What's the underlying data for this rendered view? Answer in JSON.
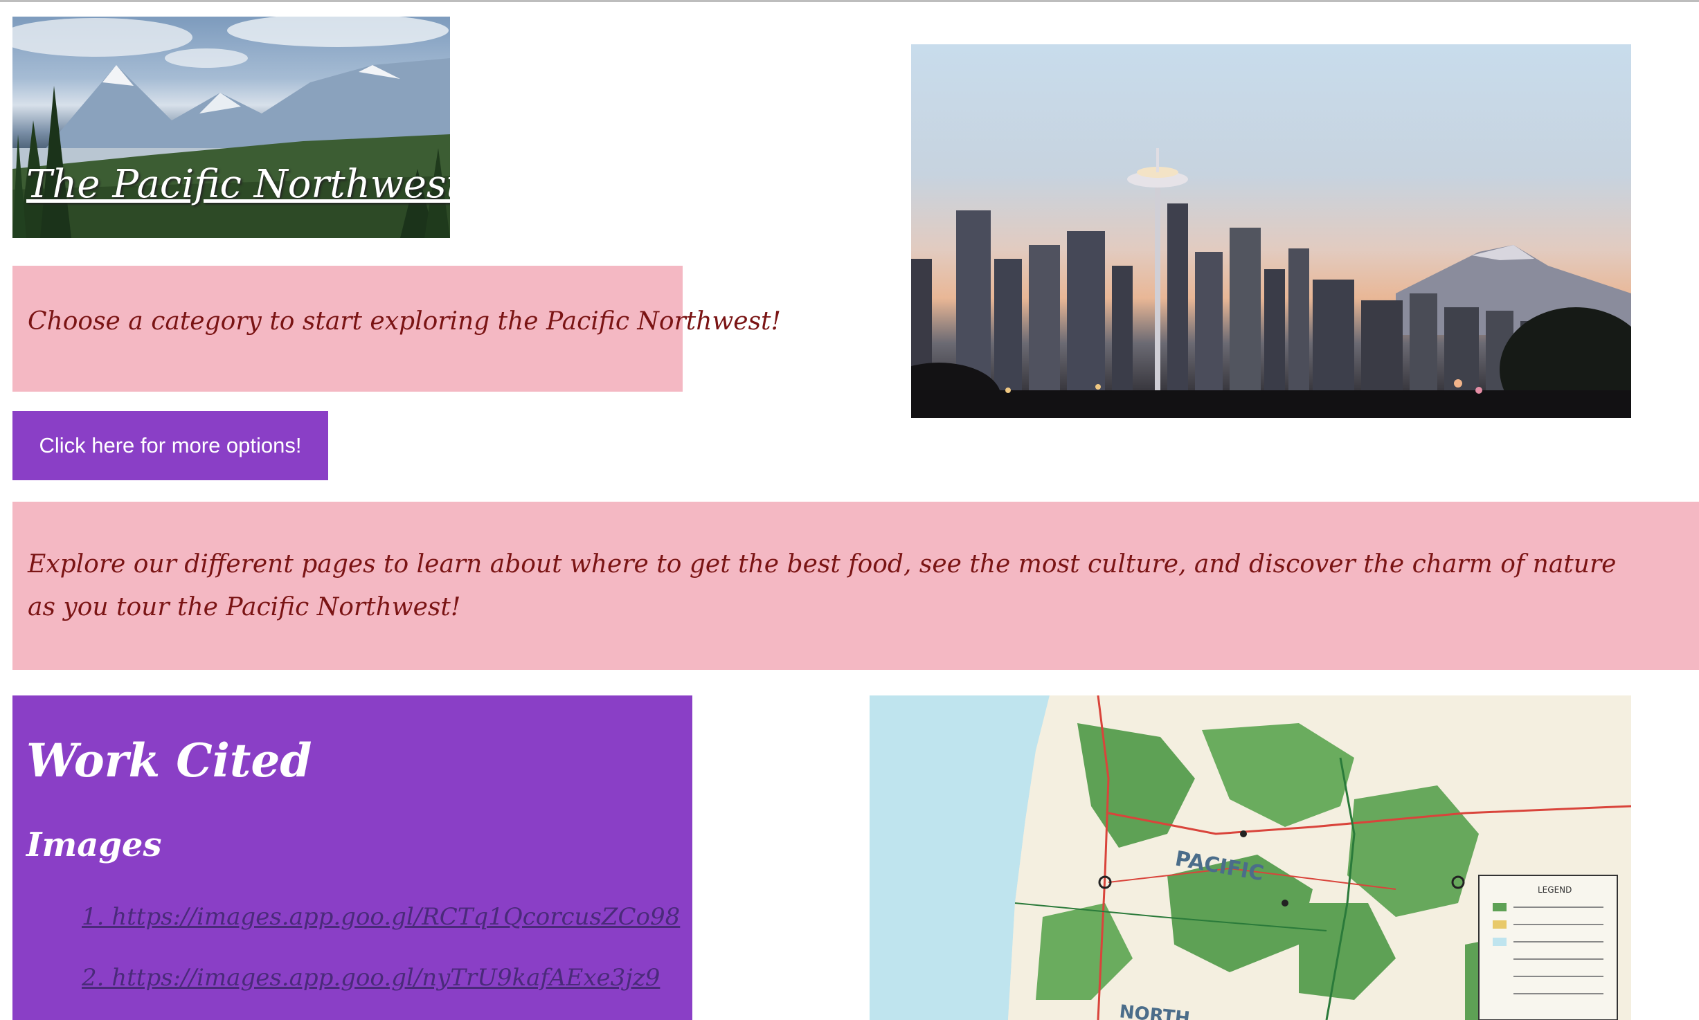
{
  "header": {
    "title": "The Pacific Northwest"
  },
  "intro": {
    "text": "Choose a category to start exploring the Pacific Northwest!"
  },
  "options_button": {
    "label": "Click here for more options!"
  },
  "explore": {
    "text": "Explore our different pages to learn about where to get the best food, see the most culture, and discover the charm of nature as you tour the Pacific Northwest!"
  },
  "works_cited": {
    "heading": "Work Cited",
    "images_heading": "Images",
    "links": [
      "1. https://images.app.goo.gl/RCTq1QcorcusZCo98",
      "2. https://images.app.goo.gl/nyTrU9kafAExe3jz9"
    ]
  },
  "map": {
    "label_pacific": "PACIFIC",
    "label_north": "NORTH",
    "legend_title": "LEGEND"
  },
  "colors": {
    "pink_box": "#f4b8c3",
    "purple": "#8a3fc6",
    "dark_red_text": "#7a1414"
  }
}
